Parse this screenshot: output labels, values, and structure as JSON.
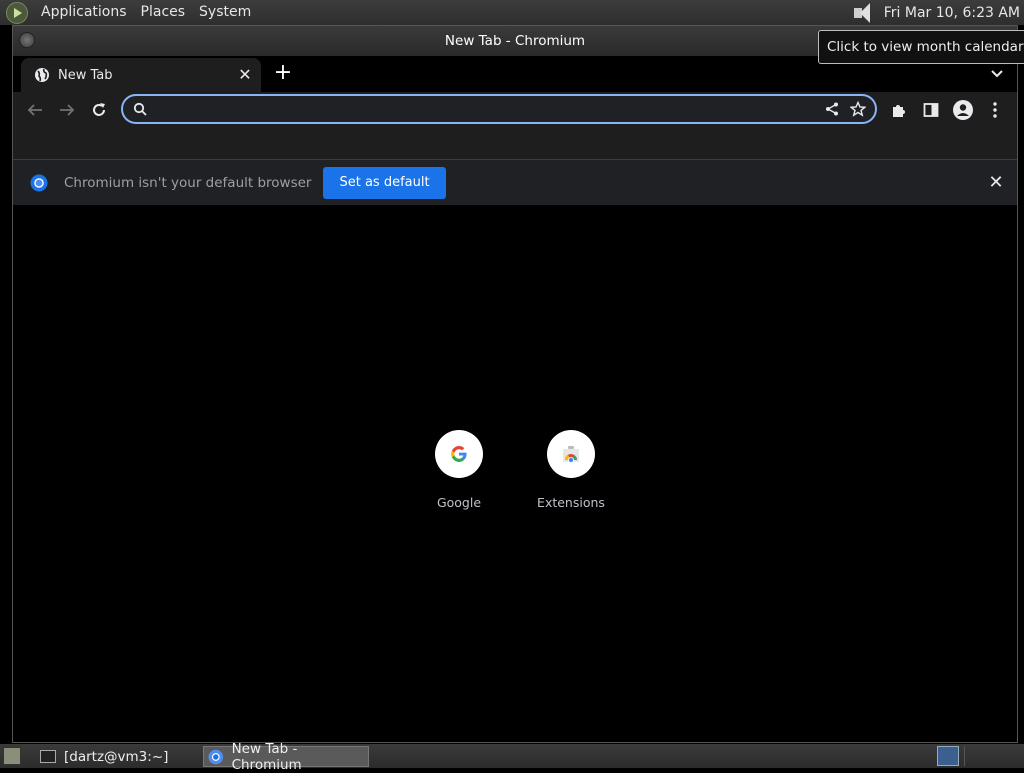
{
  "top_panel": {
    "menus": [
      "Applications",
      "Places",
      "System"
    ],
    "clock": "Fri Mar 10,  6:23 AM",
    "tooltip": "Click to view month calendar"
  },
  "window": {
    "title": "New Tab - Chromium"
  },
  "tabs": [
    {
      "label": "New Tab",
      "icon": "globe-icon"
    }
  ],
  "toolbar": {
    "omnibox_value": ""
  },
  "infobar": {
    "message": "Chromium isn't your default browser",
    "button_label": "Set as default"
  },
  "shortcuts": [
    {
      "label": "Google",
      "icon": "google-icon"
    },
    {
      "label": "Extensions",
      "icon": "chrome-web-store-icon"
    }
  ],
  "taskbar": {
    "tasks": [
      {
        "label": "[dartz@vm3:~]",
        "icon": "terminal-icon"
      },
      {
        "label": "New Tab - Chromium",
        "icon": "chromium-icon"
      }
    ]
  },
  "colors": {
    "accent": "#1a73e8",
    "focus_ring": "#8ab4f8",
    "background": "#000000"
  }
}
